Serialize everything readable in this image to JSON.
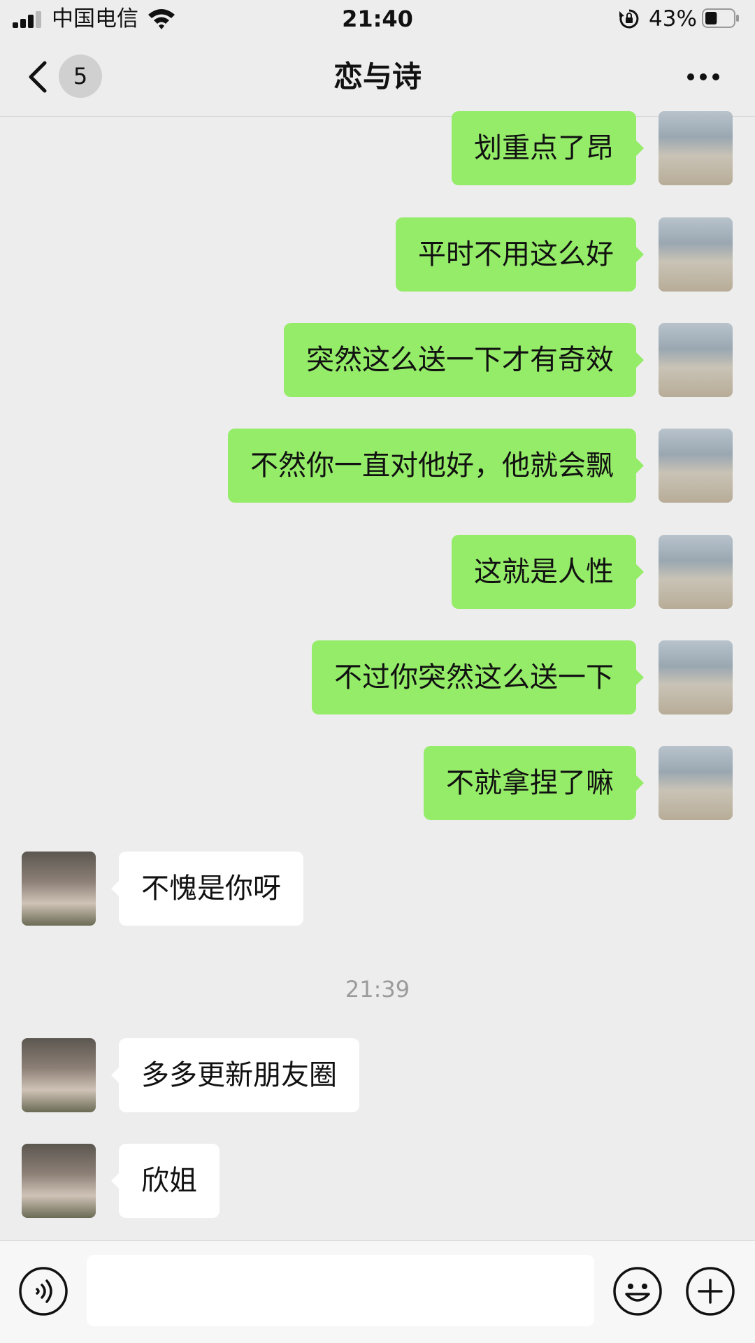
{
  "status_bar": {
    "carrier": "中国电信",
    "time": "21:40",
    "battery_percent": "43%",
    "battery_level": 0.43,
    "icons": [
      "signal-icon",
      "wifi-icon",
      "orientation-lock-icon",
      "battery-icon"
    ]
  },
  "nav": {
    "unread_count": "5",
    "title": "恋与诗",
    "icons": [
      "back-arrow-icon",
      "more-dots-icon"
    ]
  },
  "messages": [
    {
      "direction": "out",
      "text": "划重点了昂"
    },
    {
      "direction": "out",
      "text": "平时不用这么好"
    },
    {
      "direction": "out",
      "text": "突然这么送一下才有奇效"
    },
    {
      "direction": "out",
      "text": "不然你一直对他好，他就会飘"
    },
    {
      "direction": "out",
      "text": "这就是人性"
    },
    {
      "direction": "out",
      "text": "不过你突然这么送一下"
    },
    {
      "direction": "out",
      "text": "不就拿捏了嘛"
    },
    {
      "direction": "in",
      "text": "不愧是你呀"
    },
    {
      "direction": "in",
      "text": "多多更新朋友圈"
    },
    {
      "direction": "in",
      "text": "欣姐"
    }
  ],
  "timestamp": "21:39",
  "input_bar": {
    "value": "",
    "placeholder": "",
    "icons": [
      "voice-icon",
      "emoji-icon",
      "plus-icon"
    ]
  },
  "colors": {
    "background": "#ededed",
    "outgoing_bubble": "#95ec69",
    "incoming_bubble": "#ffffff",
    "timestamp_text": "#9b9b9b"
  }
}
